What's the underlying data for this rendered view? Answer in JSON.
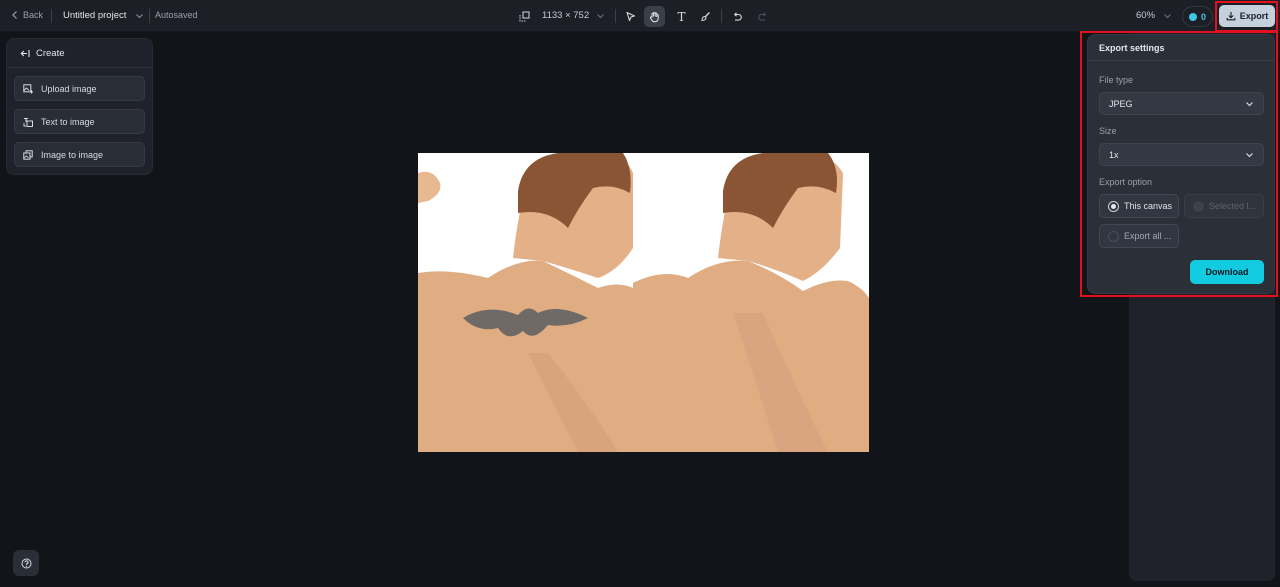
{
  "topbar": {
    "back_label": "Back",
    "project_title": "Untitled project",
    "save_status": "Autosaved",
    "canvas_size": "1133 × 752",
    "zoom": "60%",
    "credits": "0",
    "export_label": "Export",
    "tools": [
      "select-tool",
      "hand-tool",
      "text-tool",
      "brush-tool"
    ],
    "active_tool": "hand-tool"
  },
  "left_panel": {
    "header": "Create",
    "items": [
      {
        "label": "Upload image",
        "icon": "upload-image-icon"
      },
      {
        "label": "Text to image",
        "icon": "text-to-image-icon"
      },
      {
        "label": "Image to image",
        "icon": "image-to-image-icon"
      }
    ]
  },
  "export_settings": {
    "title": "Export settings",
    "file_type_label": "File type",
    "file_type_value": "JPEG",
    "size_label": "Size",
    "size_value": "1x",
    "export_option_label": "Export option",
    "options": [
      {
        "label": "This canvas",
        "state": "selected"
      },
      {
        "label": "Selected l...",
        "state": "disabled"
      },
      {
        "label": "Export all ...",
        "state": "unselected"
      }
    ],
    "download_label": "Download"
  },
  "canvas": {
    "description": "Side-by-side before/after photo of a man's back: left with tribal tattoo, right with tattoo removed"
  },
  "colors": {
    "accent": "#12cbe0",
    "highlight": "#e3101e",
    "background": "#111419"
  }
}
